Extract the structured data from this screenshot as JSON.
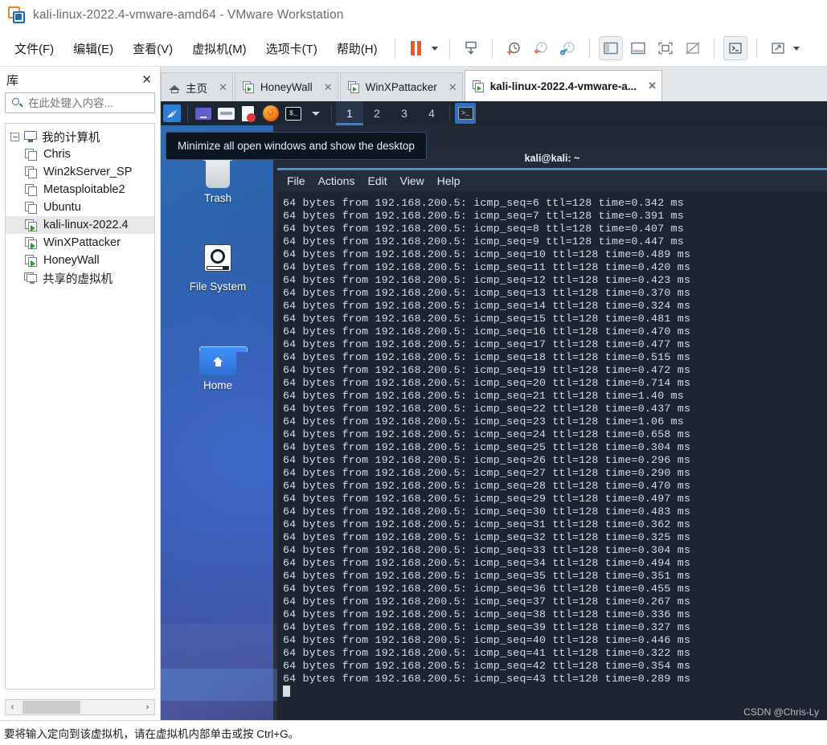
{
  "window": {
    "title": "kali-linux-2022.4-vmware-amd64 - VMware Workstation",
    "logo_icon": "vmware-logo-icon"
  },
  "menubar": {
    "items": [
      {
        "label": "文件(F)",
        "name": "menu-file"
      },
      {
        "label": "编辑(E)",
        "name": "menu-edit"
      },
      {
        "label": "查看(V)",
        "name": "menu-view"
      },
      {
        "label": "虚拟机(M)",
        "name": "menu-vm"
      },
      {
        "label": "选项卡(T)",
        "name": "menu-tabs"
      },
      {
        "label": "帮助(H)",
        "name": "menu-help"
      }
    ],
    "toolbar": [
      {
        "icon": "pause-icon",
        "name": "toolbar-suspend"
      },
      {
        "icon": "chevron-down-icon",
        "name": "toolbar-power-dropdown"
      },
      {
        "icon": "snapshot-manager-icon",
        "name": "toolbar-snapshot-manager"
      },
      {
        "icon": "take-snapshot-icon",
        "name": "toolbar-take-snapshot"
      },
      {
        "icon": "revert-snapshot-icon",
        "name": "toolbar-revert-snapshot"
      },
      {
        "icon": "manage-snapshots-icon",
        "name": "toolbar-manage-snapshots"
      },
      {
        "icon": "show-library-icon",
        "name": "toolbar-show-library"
      },
      {
        "icon": "show-thumbnail-bar-icon",
        "name": "toolbar-show-thumbnail-bar"
      },
      {
        "icon": "fullscreen-icon",
        "name": "toolbar-enter-fullscreen"
      },
      {
        "icon": "unity-mode-icon",
        "name": "toolbar-unity-mode"
      },
      {
        "icon": "console-icon",
        "name": "toolbar-console-view"
      },
      {
        "icon": "stretch-icon",
        "name": "toolbar-stretch-guest"
      },
      {
        "icon": "chevron-down-icon",
        "name": "toolbar-stretch-dropdown"
      }
    ]
  },
  "library": {
    "title": "库",
    "close_label": "✕",
    "search_placeholder": "在此处键入内容...",
    "search_value": "",
    "tree": [
      {
        "label": "我的计算机",
        "icon": "monitor-icon",
        "level": 0,
        "expanded": true,
        "selected": false
      },
      {
        "label": "Chris",
        "icon": "vm-icon",
        "level": 1,
        "running": false,
        "selected": false
      },
      {
        "label": "Win2kServer_SP",
        "icon": "vm-icon",
        "level": 1,
        "running": false,
        "selected": false
      },
      {
        "label": "Metasploitable2",
        "icon": "vm-icon",
        "level": 1,
        "running": false,
        "selected": false
      },
      {
        "label": "Ubuntu",
        "icon": "vm-icon",
        "level": 1,
        "running": false,
        "selected": false
      },
      {
        "label": "kali-linux-2022.4",
        "icon": "vm-icon",
        "level": 1,
        "running": true,
        "selected": true
      },
      {
        "label": "WinXPattacker",
        "icon": "vm-icon",
        "level": 1,
        "running": true,
        "selected": false
      },
      {
        "label": "HoneyWall",
        "icon": "vm-icon",
        "level": 1,
        "running": true,
        "selected": false
      },
      {
        "label": "共享的虚拟机",
        "icon": "shared-vm-icon",
        "level": 0,
        "running": false,
        "selected": false
      }
    ],
    "scroll_left": "‹",
    "scroll_right": "›"
  },
  "tabs": [
    {
      "label": "主页",
      "icon": "home-icon",
      "close": "✕",
      "active": false
    },
    {
      "label": "HoneyWall",
      "icon": "vm-icon",
      "close": "✕",
      "active": false
    },
    {
      "label": "WinXPattacker",
      "icon": "vm-icon",
      "close": "✕",
      "active": false
    },
    {
      "label": "kali-linux-2022.4-vmware-a...",
      "icon": "vm-icon",
      "close": "✕",
      "active": true
    }
  ],
  "guest": {
    "panel": {
      "launcher_icon": "kali-dragon-icon",
      "buttons": [
        {
          "icon": "show-desktop-icon",
          "name": "panel-show-desktop"
        },
        {
          "icon": "file-manager-icon",
          "name": "panel-file-manager"
        },
        {
          "icon": "text-editor-icon",
          "name": "panel-text-editor"
        },
        {
          "icon": "firefox-icon",
          "name": "panel-firefox"
        },
        {
          "icon": "terminal-icon",
          "name": "panel-terminal"
        }
      ],
      "dropdown_icon": "chevron-down-icon",
      "workspaces": [
        "1",
        "2",
        "3",
        "4"
      ],
      "current_workspace": "1",
      "task_icon": "terminal-icon"
    },
    "tooltip": "Minimize all open windows and show the desktop",
    "desktop_icons": [
      {
        "label": "Trash",
        "icon": "trash-icon"
      },
      {
        "label": "File System",
        "icon": "filesystem-icon"
      },
      {
        "label": "Home",
        "icon": "home-folder-icon"
      }
    ],
    "terminal": {
      "title": "kali@kali: ~",
      "menu": [
        "File",
        "Actions",
        "Edit",
        "View",
        "Help"
      ],
      "lines": [
        "64 bytes from 192.168.200.5: icmp_seq=6 ttl=128 time=0.342 ms",
        "64 bytes from 192.168.200.5: icmp_seq=7 ttl=128 time=0.391 ms",
        "64 bytes from 192.168.200.5: icmp_seq=8 ttl=128 time=0.407 ms",
        "64 bytes from 192.168.200.5: icmp_seq=9 ttl=128 time=0.447 ms",
        "64 bytes from 192.168.200.5: icmp_seq=10 ttl=128 time=0.489 ms",
        "64 bytes from 192.168.200.5: icmp_seq=11 ttl=128 time=0.420 ms",
        "64 bytes from 192.168.200.5: icmp_seq=12 ttl=128 time=0.423 ms",
        "64 bytes from 192.168.200.5: icmp_seq=13 ttl=128 time=0.370 ms",
        "64 bytes from 192.168.200.5: icmp_seq=14 ttl=128 time=0.324 ms",
        "64 bytes from 192.168.200.5: icmp_seq=15 ttl=128 time=0.481 ms",
        "64 bytes from 192.168.200.5: icmp_seq=16 ttl=128 time=0.470 ms",
        "64 bytes from 192.168.200.5: icmp_seq=17 ttl=128 time=0.477 ms",
        "64 bytes from 192.168.200.5: icmp_seq=18 ttl=128 time=0.515 ms",
        "64 bytes from 192.168.200.5: icmp_seq=19 ttl=128 time=0.472 ms",
        "64 bytes from 192.168.200.5: icmp_seq=20 ttl=128 time=0.714 ms",
        "64 bytes from 192.168.200.5: icmp_seq=21 ttl=128 time=1.40 ms",
        "64 bytes from 192.168.200.5: icmp_seq=22 ttl=128 time=0.437 ms",
        "64 bytes from 192.168.200.5: icmp_seq=23 ttl=128 time=1.06 ms",
        "64 bytes from 192.168.200.5: icmp_seq=24 ttl=128 time=0.658 ms",
        "64 bytes from 192.168.200.5: icmp_seq=25 ttl=128 time=0.304 ms",
        "64 bytes from 192.168.200.5: icmp_seq=26 ttl=128 time=0.296 ms",
        "64 bytes from 192.168.200.5: icmp_seq=27 ttl=128 time=0.290 ms",
        "64 bytes from 192.168.200.5: icmp_seq=28 ttl=128 time=0.470 ms",
        "64 bytes from 192.168.200.5: icmp_seq=29 ttl=128 time=0.497 ms",
        "64 bytes from 192.168.200.5: icmp_seq=30 ttl=128 time=0.483 ms",
        "64 bytes from 192.168.200.5: icmp_seq=31 ttl=128 time=0.362 ms",
        "64 bytes from 192.168.200.5: icmp_seq=32 ttl=128 time=0.325 ms",
        "64 bytes from 192.168.200.5: icmp_seq=33 ttl=128 time=0.304 ms",
        "64 bytes from 192.168.200.5: icmp_seq=34 ttl=128 time=0.494 ms",
        "64 bytes from 192.168.200.5: icmp_seq=35 ttl=128 time=0.351 ms",
        "64 bytes from 192.168.200.5: icmp_seq=36 ttl=128 time=0.455 ms",
        "64 bytes from 192.168.200.5: icmp_seq=37 ttl=128 time=0.267 ms",
        "64 bytes from 192.168.200.5: icmp_seq=38 ttl=128 time=0.336 ms",
        "64 bytes from 192.168.200.5: icmp_seq=39 ttl=128 time=0.327 ms",
        "64 bytes from 192.168.200.5: icmp_seq=40 ttl=128 time=0.446 ms",
        "64 bytes from 192.168.200.5: icmp_seq=41 ttl=128 time=0.322 ms",
        "64 bytes from 192.168.200.5: icmp_seq=42 ttl=128 time=0.354 ms",
        "64 bytes from 192.168.200.5: icmp_seq=43 ttl=128 time=0.289 ms"
      ]
    }
  },
  "statusbar": {
    "text": "要将输入定向到该虚拟机，请在虚拟机内部单击或按 Ctrl+G。"
  },
  "watermark": "CSDN @Chris-Ly",
  "colors": {
    "accent_orange": "#f05a28",
    "accent_blue": "#2b7fd4",
    "terminal_bg": "#1e2430",
    "panel_bg": "#1d2633"
  }
}
